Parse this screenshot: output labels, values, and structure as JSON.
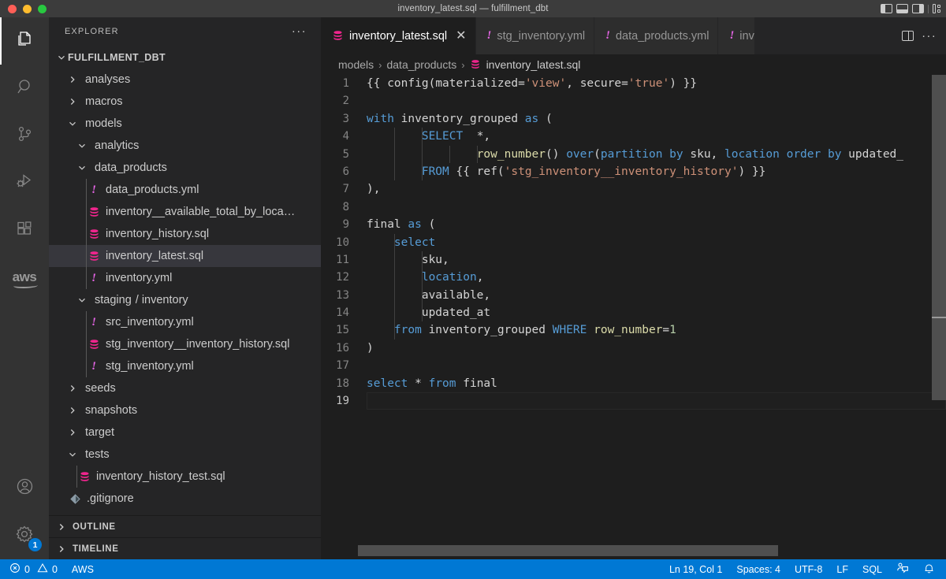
{
  "window": {
    "title": "inventory_latest.sql — fulfillment_dbt",
    "traffic_lights": [
      "close",
      "minimize",
      "zoom"
    ],
    "layout_controls": [
      {
        "name": "toggle-primary-sidebar",
        "label": "Toggle Primary Side Bar"
      },
      {
        "name": "toggle-panel",
        "label": "Toggle Panel"
      },
      {
        "name": "toggle-secondary-sidebar",
        "label": "Toggle Secondary Side Bar"
      },
      {
        "name": "customize-layout",
        "label": "Customize Layout"
      }
    ]
  },
  "activitybar": {
    "items": [
      {
        "icon": "files-icon",
        "name": "explorer",
        "label": "Explorer",
        "active": true
      },
      {
        "icon": "search-icon",
        "name": "search",
        "label": "Search",
        "active": false
      },
      {
        "icon": "source-control-icon",
        "name": "source-control",
        "label": "Source Control",
        "active": false
      },
      {
        "icon": "run-debug-icon",
        "name": "run-and-debug",
        "label": "Run and Debug",
        "active": false
      },
      {
        "icon": "extensions-icon",
        "name": "extensions",
        "label": "Extensions",
        "active": false
      },
      {
        "icon": "aws-icon",
        "name": "aws-toolkit",
        "label": "aws",
        "active": false
      }
    ],
    "bottom": [
      {
        "icon": "account-icon",
        "name": "accounts",
        "label": "Accounts"
      },
      {
        "icon": "gear-icon",
        "name": "manage-settings",
        "label": "Manage",
        "badge": "1"
      }
    ],
    "badge_color": "#0078d4"
  },
  "sidebar": {
    "title": "EXPLORER",
    "actions_label": "···",
    "root": {
      "label": "FULFILLMENT_DBT",
      "expanded": true
    },
    "tree": [
      {
        "label": "analyses",
        "type": "folder",
        "expanded": false,
        "depth": 1
      },
      {
        "label": "macros",
        "type": "folder",
        "expanded": false,
        "depth": 1
      },
      {
        "label": "models",
        "type": "folder",
        "expanded": true,
        "depth": 1
      },
      {
        "label": "analytics",
        "type": "folder",
        "expanded": true,
        "depth": 2
      },
      {
        "label": "data_products",
        "type": "folder",
        "expanded": true,
        "depth": 2
      },
      {
        "label": "data_products.yml",
        "type": "yml",
        "depth": 3
      },
      {
        "label": "inventory__available_total_by_loca…",
        "type": "sql",
        "depth": 3
      },
      {
        "label": "inventory_history.sql",
        "type": "sql",
        "depth": 3
      },
      {
        "label": "inventory_latest.sql",
        "type": "sql",
        "depth": 3,
        "selected": true
      },
      {
        "label": "inventory.yml",
        "type": "yml",
        "depth": 3
      },
      {
        "label": "staging",
        "label_suffix": "/ inventory",
        "type": "folder",
        "expanded": true,
        "depth": 2
      },
      {
        "label": "src_inventory.yml",
        "type": "yml",
        "depth": 3
      },
      {
        "label": "stg_inventory__inventory_history.sql",
        "type": "sql",
        "depth": 3
      },
      {
        "label": "stg_inventory.yml",
        "type": "yml",
        "depth": 3
      },
      {
        "label": "seeds",
        "type": "folder",
        "expanded": false,
        "depth": 1
      },
      {
        "label": "snapshots",
        "type": "folder",
        "expanded": false,
        "depth": 1
      },
      {
        "label": "target",
        "type": "folder",
        "expanded": false,
        "depth": 1
      },
      {
        "label": "tests",
        "type": "folder",
        "expanded": true,
        "depth": 1
      },
      {
        "label": "inventory_history_test.sql",
        "type": "sql",
        "depth": 2
      },
      {
        "label": ".gitignore",
        "type": "git",
        "depth": 1
      }
    ],
    "panels": [
      {
        "label": "OUTLINE",
        "expanded": false
      },
      {
        "label": "TIMELINE",
        "expanded": false
      }
    ],
    "icon_colors": {
      "sql": "#f0258d",
      "yml": "#e765e7",
      "git": "#8b9ba6"
    }
  },
  "editor": {
    "tabs": [
      {
        "label": "inventory_latest.sql",
        "type": "sql",
        "active": true,
        "closable": true
      },
      {
        "label": "stg_inventory.yml",
        "type": "yml",
        "active": false
      },
      {
        "label": "data_products.yml",
        "type": "yml",
        "active": false
      },
      {
        "label": "inv",
        "type": "yml",
        "active": false,
        "truncated": true
      }
    ],
    "tab_actions": [
      {
        "name": "split-editor-right-icon",
        "label": "Split Editor Right"
      },
      {
        "name": "editor-more-actions-icon",
        "label": "···"
      }
    ],
    "breadcrumb": [
      "models",
      "data_products",
      "inventory_latest.sql"
    ],
    "code_lines": [
      {
        "n": "1",
        "tokens": [
          {
            "t": "{{ ",
            "c": "pl"
          },
          {
            "t": "config",
            "c": "pl"
          },
          {
            "t": "(",
            "c": "pl"
          },
          {
            "t": "materialized=",
            "c": "pl"
          },
          {
            "t": "'view'",
            "c": "str"
          },
          {
            "t": ", ",
            "c": "pl"
          },
          {
            "t": "secure=",
            "c": "pl"
          },
          {
            "t": "'true'",
            "c": "str"
          },
          {
            "t": ") }}",
            "c": "pl"
          }
        ],
        "indents": 0
      },
      {
        "n": "2",
        "tokens": [],
        "indents": 0
      },
      {
        "n": "3",
        "tokens": [
          {
            "t": "with",
            "c": "kw"
          },
          {
            "t": " inventory_grouped ",
            "c": "pl"
          },
          {
            "t": "as",
            "c": "kw"
          },
          {
            "t": " (",
            "c": "pl"
          }
        ],
        "indents": 0
      },
      {
        "n": "4",
        "tokens": [
          {
            "t": "        ",
            "c": "pl"
          },
          {
            "t": "SELECT",
            "c": "kw"
          },
          {
            "t": "  *,",
            "c": "pl"
          }
        ],
        "indents": 2
      },
      {
        "n": "5",
        "tokens": [
          {
            "t": "                ",
            "c": "pl"
          },
          {
            "t": "row_number",
            "c": "fn"
          },
          {
            "t": "() ",
            "c": "pl"
          },
          {
            "t": "over",
            "c": "kw"
          },
          {
            "t": "(",
            "c": "pl"
          },
          {
            "t": "partition by",
            "c": "kw"
          },
          {
            "t": " sku, ",
            "c": "pl"
          },
          {
            "t": "location",
            "c": "kw"
          },
          {
            "t": " ",
            "c": "pl"
          },
          {
            "t": "order by",
            "c": "kw"
          },
          {
            "t": " updated_",
            "c": "pl"
          }
        ],
        "indents": 4
      },
      {
        "n": "6",
        "tokens": [
          {
            "t": "        ",
            "c": "pl"
          },
          {
            "t": "FROM",
            "c": "kw"
          },
          {
            "t": " {{ ",
            "c": "pl"
          },
          {
            "t": "ref",
            "c": "pl"
          },
          {
            "t": "(",
            "c": "pl"
          },
          {
            "t": "'stg_inventory__inventory_history'",
            "c": "str"
          },
          {
            "t": ") }}",
            "c": "pl"
          }
        ],
        "indents": 2
      },
      {
        "n": "7",
        "tokens": [
          {
            "t": "),",
            "c": "pl"
          }
        ],
        "indents": 0
      },
      {
        "n": "8",
        "tokens": [],
        "indents": 0
      },
      {
        "n": "9",
        "tokens": [
          {
            "t": "final ",
            "c": "pl"
          },
          {
            "t": "as",
            "c": "kw"
          },
          {
            "t": " (",
            "c": "pl"
          }
        ],
        "indents": 0
      },
      {
        "n": "10",
        "tokens": [
          {
            "t": "    ",
            "c": "pl"
          },
          {
            "t": "select",
            "c": "kw"
          }
        ],
        "indents": 1
      },
      {
        "n": "11",
        "tokens": [
          {
            "t": "        sku,",
            "c": "pl"
          }
        ],
        "indents": 2
      },
      {
        "n": "12",
        "tokens": [
          {
            "t": "        ",
            "c": "pl"
          },
          {
            "t": "location",
            "c": "kw"
          },
          {
            "t": ",",
            "c": "pl"
          }
        ],
        "indents": 2
      },
      {
        "n": "13",
        "tokens": [
          {
            "t": "        available,",
            "c": "pl"
          }
        ],
        "indents": 2
      },
      {
        "n": "14",
        "tokens": [
          {
            "t": "        updated_at",
            "c": "pl"
          }
        ],
        "indents": 2
      },
      {
        "n": "15",
        "tokens": [
          {
            "t": "    ",
            "c": "pl"
          },
          {
            "t": "from",
            "c": "kw"
          },
          {
            "t": " inventory_grouped ",
            "c": "pl"
          },
          {
            "t": "WHERE",
            "c": "kw"
          },
          {
            "t": " ",
            "c": "pl"
          },
          {
            "t": "row_number",
            "c": "fn"
          },
          {
            "t": "=",
            "c": "pl"
          },
          {
            "t": "1",
            "c": "num"
          }
        ],
        "indents": 1
      },
      {
        "n": "16",
        "tokens": [
          {
            "t": ")",
            "c": "pl"
          }
        ],
        "indents": 0
      },
      {
        "n": "17",
        "tokens": [],
        "indents": 0
      },
      {
        "n": "18",
        "tokens": [
          {
            "t": "select",
            "c": "kw"
          },
          {
            "t": " * ",
            "c": "pl"
          },
          {
            "t": "from",
            "c": "kw"
          },
          {
            "t": " final",
            "c": "pl"
          }
        ],
        "indents": 0
      },
      {
        "n": "19",
        "tokens": [],
        "indents": 0,
        "current": true
      }
    ]
  },
  "statusbar": {
    "background": "#0078d4",
    "left": [
      {
        "name": "problems",
        "errors": "0",
        "warnings": "0"
      },
      {
        "name": "aws-connection",
        "label": "AWS"
      }
    ],
    "right": [
      {
        "name": "editor-position",
        "label": "Ln 19, Col 1"
      },
      {
        "name": "editor-indentation",
        "label": "Spaces: 4"
      },
      {
        "name": "editor-encoding",
        "label": "UTF-8"
      },
      {
        "name": "editor-eol",
        "label": "LF"
      },
      {
        "name": "editor-language",
        "label": "SQL"
      },
      {
        "name": "feedback-icon",
        "label": ""
      },
      {
        "name": "notifications-bell-icon",
        "label": ""
      }
    ]
  }
}
